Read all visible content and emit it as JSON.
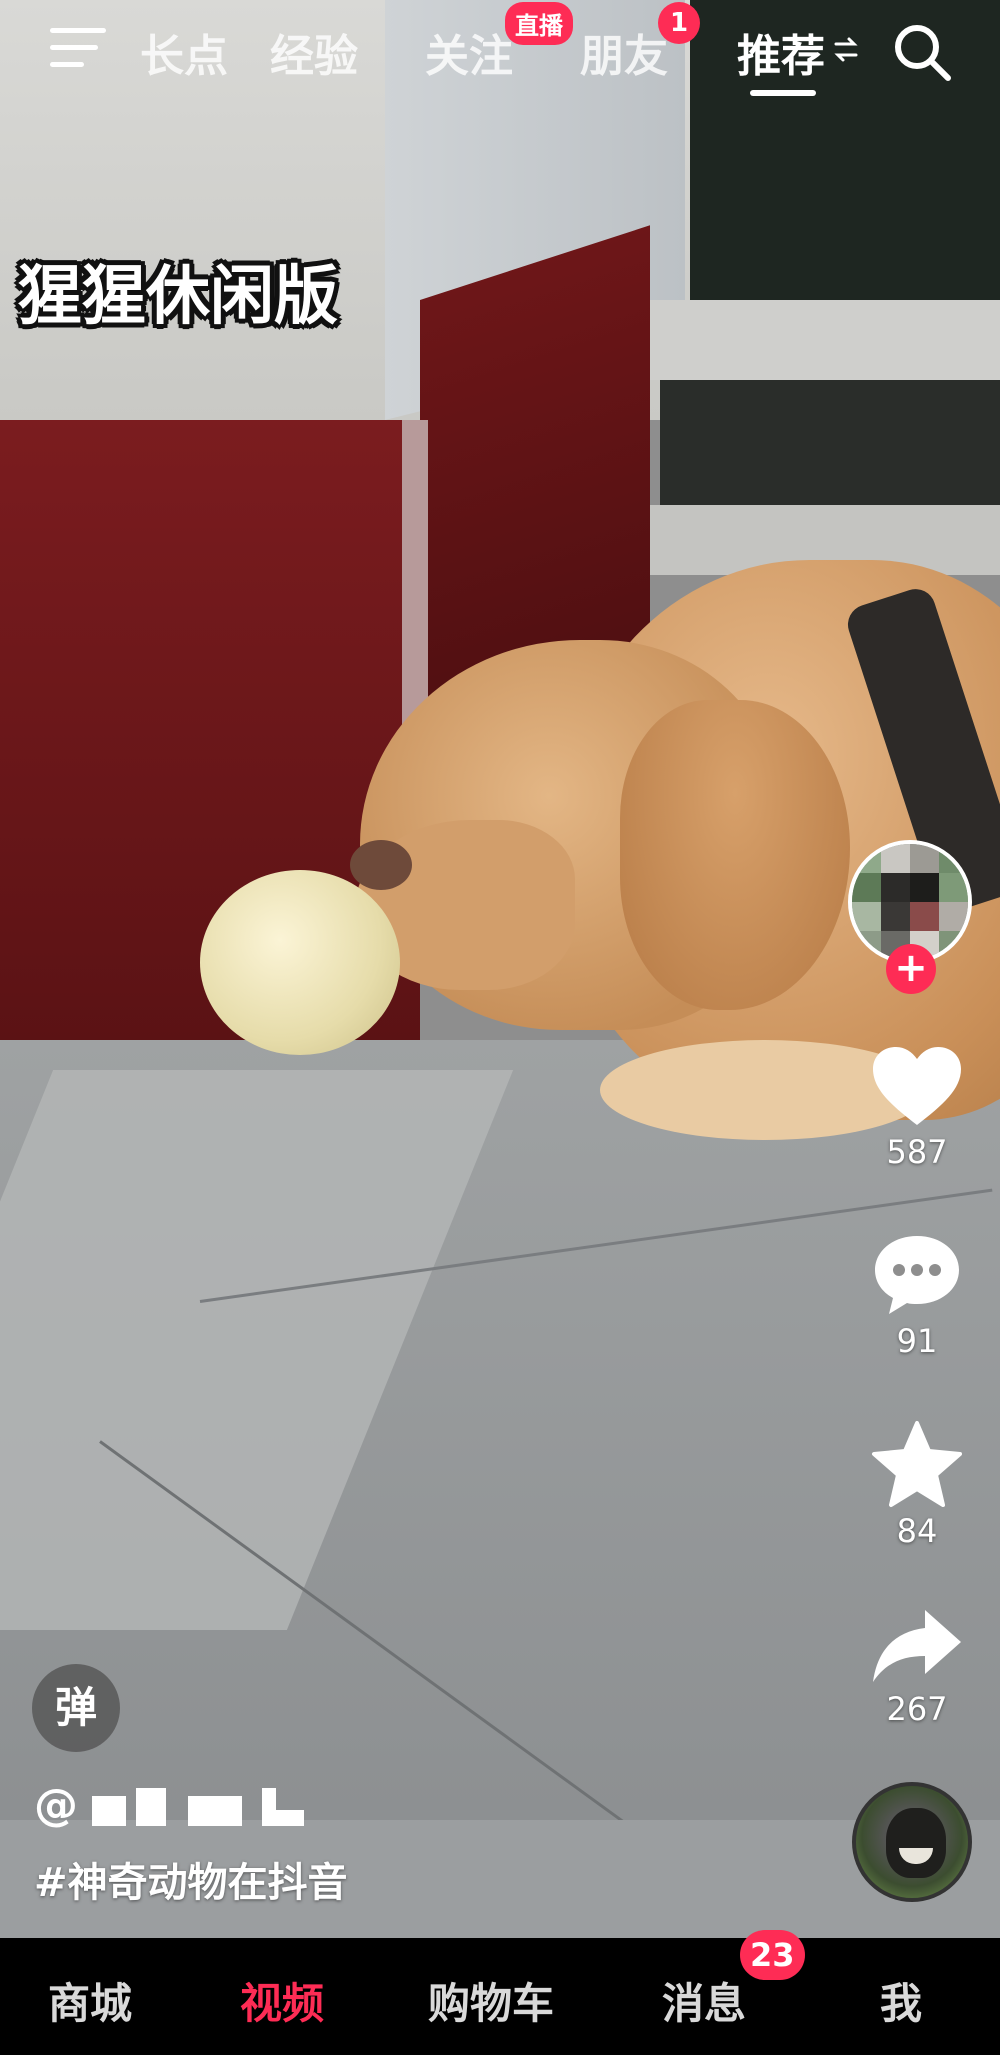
{
  "video": {
    "overlay_caption": "猩猩休闲版"
  },
  "top_nav": {
    "tabs": [
      {
        "label": "长点",
        "active": false
      },
      {
        "label": "经验",
        "active": false
      },
      {
        "label": "关注",
        "active": false,
        "badge": "直播"
      },
      {
        "label": "朋友",
        "active": false,
        "badge": "1"
      },
      {
        "label": "推荐",
        "active": true
      }
    ],
    "icons": [
      "menu-icon",
      "swap-icon",
      "search-icon"
    ]
  },
  "actions": {
    "like": {
      "icon": "heart-icon",
      "count": "587"
    },
    "comment": {
      "icon": "comment-icon",
      "count": "91"
    },
    "favorite": {
      "icon": "star-icon",
      "count": "84"
    },
    "share": {
      "icon": "share-icon",
      "count": "267"
    },
    "follow_symbol": "+"
  },
  "info": {
    "danmu_label": "弹",
    "author_prefix": "@",
    "hashtag": "#神奇动物在抖音"
  },
  "bottom_nav": {
    "tabs": [
      {
        "label": "商城",
        "active": false
      },
      {
        "label": "视频",
        "active": true
      },
      {
        "label": "购物车",
        "active": false
      },
      {
        "label": "消息",
        "active": false,
        "badge": "23"
      },
      {
        "label": "我",
        "active": false
      }
    ]
  },
  "colors": {
    "accent": "#fe2c55",
    "text": "#ffffff",
    "bar_bg": "#000000"
  }
}
